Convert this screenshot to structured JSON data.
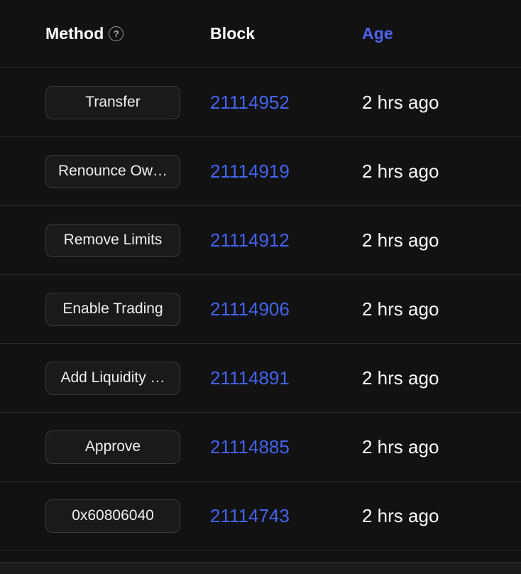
{
  "table": {
    "columns": {
      "method": {
        "label": "Method",
        "help_icon": "help-circle-icon",
        "help_glyph": "?"
      },
      "block": {
        "label": "Block"
      },
      "age": {
        "label": "Age",
        "color": "#4e63f0"
      }
    },
    "rows": [
      {
        "method": "Transfer",
        "block": "21114952",
        "age": "2 hrs ago"
      },
      {
        "method": "Renounce Ow…",
        "block": "21114919",
        "age": "2 hrs ago"
      },
      {
        "method": "Remove Limits",
        "block": "21114912",
        "age": "2 hrs ago"
      },
      {
        "method": "Enable Trading",
        "block": "21114906",
        "age": "2 hrs ago"
      },
      {
        "method": "Add Liquidity …",
        "block": "21114891",
        "age": "2 hrs ago"
      },
      {
        "method": "Approve",
        "block": "21114885",
        "age": "2 hrs ago"
      },
      {
        "method": "0x60806040",
        "block": "21114743",
        "age": "2 hrs ago"
      }
    ]
  },
  "theme": {
    "background": "#121212",
    "row_border": "#262626",
    "pill_background": "#1a1a1a",
    "pill_border": "#3a3a3a",
    "link_blue": "#4263f0",
    "text_white": "#fbfbfb",
    "footer_background": "#1b1b1b"
  }
}
